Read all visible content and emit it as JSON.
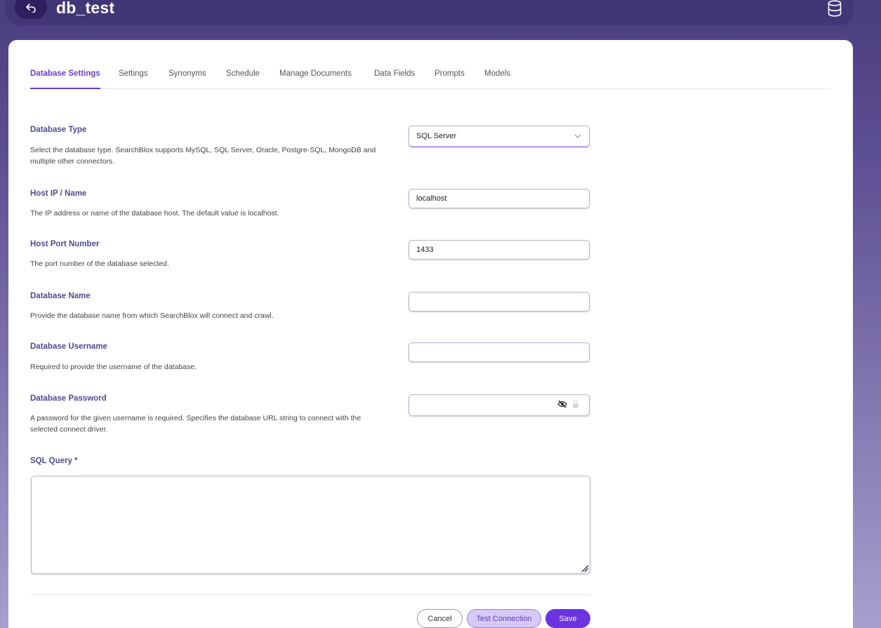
{
  "header": {
    "title": "db_test",
    "back_icon": "back-arrow-icon",
    "db_icon": "database-icon"
  },
  "tabs": [
    {
      "label": "Database Settings",
      "active": true
    },
    {
      "label": "Settings",
      "active": false
    },
    {
      "label": "Synonyms",
      "active": false
    },
    {
      "label": "Schedule",
      "active": false
    },
    {
      "label": "Manage Documents",
      "active": false
    },
    {
      "label": "Data Fields",
      "active": false
    },
    {
      "label": "Prompts",
      "active": false
    },
    {
      "label": "Models",
      "active": false
    }
  ],
  "form": {
    "database_type": {
      "label": "Database Type",
      "description": "Select the database type. SearchBlox supports MySQL, SQL Server, Oracle, Postgre-SQL, MongoDB and multiple other connectors.",
      "value": "SQL Server"
    },
    "host": {
      "label": "Host IP / Name",
      "description": "The IP address or name of the database host. The default value is localhost.",
      "value": "localhost"
    },
    "port": {
      "label": "Host Port Number",
      "description": "The port number of the database selected.",
      "value": "1433"
    },
    "database_name": {
      "label": "Database Name",
      "description": "Provide the database name from which SearchBlox will connect and crawl.",
      "value": ""
    },
    "username": {
      "label": "Database Username",
      "description": "Required to provide the username of the database.",
      "value": ""
    },
    "password": {
      "label": "Database Password",
      "description": "A password for the given username is required. Specifies the database URL string to connect with the selected connect driver.",
      "value": ""
    },
    "sql_query": {
      "label": "SQL Query *",
      "value": ""
    }
  },
  "buttons": {
    "cancel": "Cancel",
    "test": "Test Connection",
    "save": "Save"
  },
  "colors": {
    "accent": "#6a3fd0",
    "label": "#4f4a92",
    "save_bg": "#6b34e0",
    "test_bg": "#d7c9f7"
  }
}
